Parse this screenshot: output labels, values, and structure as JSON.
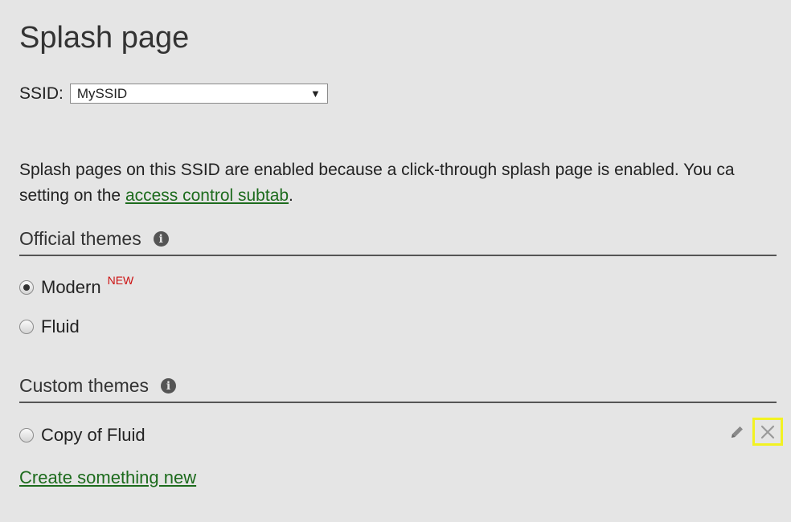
{
  "page": {
    "title": "Splash page"
  },
  "ssid": {
    "label": "SSID:",
    "selected": "MySSID"
  },
  "notice": {
    "text": "Splash pages on this SSID are enabled because a click-through splash page is enabled. You ca",
    "text2": "setting on the ",
    "link": "access control subtab",
    "suffix": "."
  },
  "official_themes": {
    "header": "Official themes",
    "items": [
      {
        "label": "Modern",
        "badge": "NEW",
        "selected": true
      },
      {
        "label": "Fluid",
        "selected": false
      }
    ]
  },
  "custom_themes": {
    "header": "Custom themes",
    "items": [
      {
        "label": "Copy of Fluid",
        "selected": false
      }
    ],
    "create_link": "Create something new"
  },
  "colors": {
    "background": "#e5e5e5",
    "link": "#1d6b1d",
    "new_badge": "#cc1111",
    "highlight": "#f2f222"
  },
  "icons": {
    "info": "info-icon",
    "edit": "pencil-icon",
    "delete": "close-icon",
    "dropdown": "chevron-down-icon"
  }
}
